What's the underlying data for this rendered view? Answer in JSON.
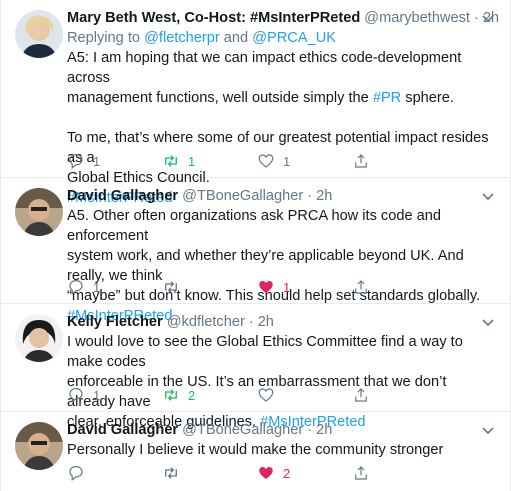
{
  "tweets": [
    {
      "name": "Mary Beth West, Co-Host: #MsInterPReted",
      "handle": "@marybethwest",
      "time": "2h",
      "replying_prefix": "Replying to",
      "replying_to": [
        "@fletcherpr",
        "@PRCA_UK"
      ],
      "replying_and": "and",
      "body_line1": "A5: I am hoping that we can impact ethics code-development across",
      "body_line2_pre": "management functions, well outside simply the ",
      "body_line2_tag": "#PR",
      "body_line2_post": " sphere.",
      "body_line3": "To me, that’s where some of our greatest potential impact resides as a",
      "body_line4": "Global Ethics Council.",
      "body_line5_tag": "#MsInterPReted",
      "reply_count": "1",
      "retweet_count": "1",
      "like_count": "1"
    },
    {
      "name": "David Gallagher",
      "handle": "@TBoneGallagher",
      "time": "2h",
      "body_line1": "A5. Other often organizations ask PRCA how its code and enforcement",
      "body_line2": "system work, and whether they’re applicable beyond UK. And really, we think",
      "body_line3": "“maybe” but don’t know. This should help set standards globally.",
      "body_line4_tag": "#MsInterPReted",
      "reply_count": "1",
      "like_count": "1"
    },
    {
      "name": "Kelly Fletcher",
      "handle": "@kdfletcher",
      "time": "2h",
      "body_line1": "I would love to see the Global Ethics Committee find a way to make codes",
      "body_line2": "enforceable in the US. It’s an embarrassment that we don’t already have",
      "body_line3_pre": "clear, enforceable guidelines. ",
      "body_line3_tag": "#MsInterPReted",
      "reply_count": "1",
      "retweet_count": "2"
    },
    {
      "name": "David Gallagher",
      "handle": "@TBoneGallagher",
      "time": "2h",
      "body_line1": "Personally I believe it would make the community stronger",
      "like_count": "2"
    }
  ],
  "separator": "·",
  "colors": {
    "link": "#1da1f2",
    "retweet": "#17bf63",
    "like": "#e0245e",
    "muted": "#657786"
  }
}
